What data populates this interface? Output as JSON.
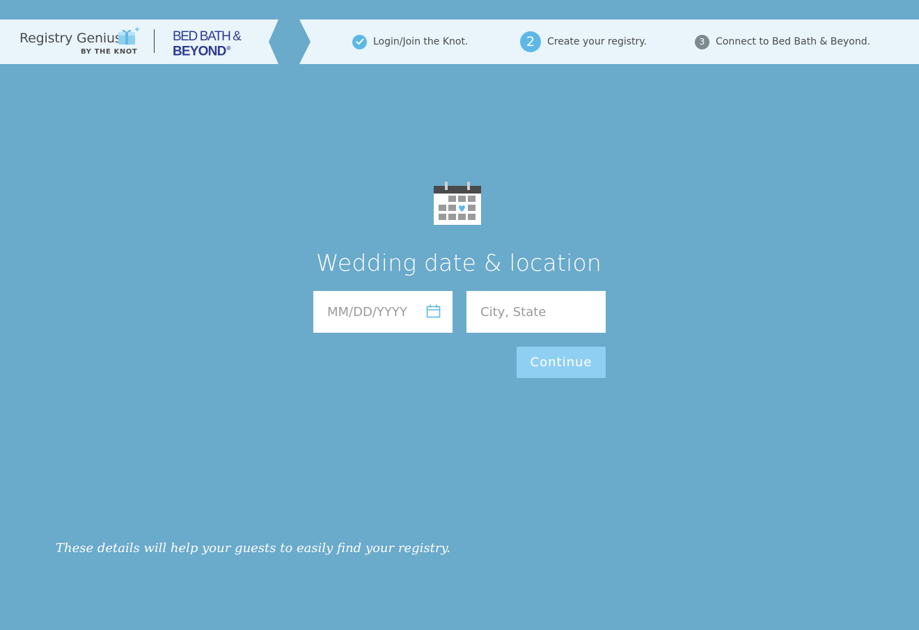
{
  "brand": {
    "product_name": "Registry Genius",
    "byline": "BY THE KNOT",
    "partner_line1": "BED BATH &",
    "partner_line2": "BEYOND",
    "partner_reg_mark": "®"
  },
  "steps": [
    {
      "label": "Login/Join the Knot.",
      "state": "complete",
      "icon": "check-icon"
    },
    {
      "number": "2",
      "label": "Create your registry.",
      "state": "active"
    },
    {
      "number": "3",
      "label": "Connect to Bed Bath & Beyond.",
      "state": "upcoming"
    }
  ],
  "form": {
    "icon": "calendar-heart-icon",
    "title": "Wedding date & location",
    "date_placeholder": "MM/DD/YYYY",
    "date_value": "",
    "date_picker_icon": "calendar-icon",
    "location_placeholder": "City, State",
    "location_value": "",
    "continue_label": "Continue"
  },
  "footer": {
    "help_text": "These details will help your guests to easily find your registry."
  },
  "colors": {
    "background": "#6aaacb",
    "header_bg": "#e9f5fb",
    "accent": "#5eb8e6",
    "button_disabled": "#8fd0f2",
    "partner_brand": "#2f3a8f",
    "inactive_step": "#7d8a90"
  }
}
